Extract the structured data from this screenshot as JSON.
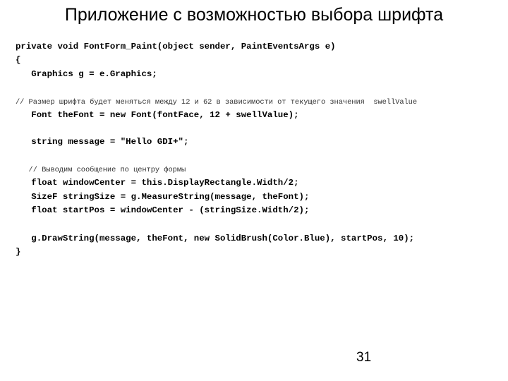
{
  "slide": {
    "title": "Приложение с возможностью выбора шрифта",
    "page_number": "31"
  },
  "code": {
    "lines": [
      "private void FontForm_Paint(object sender, PaintEventsArgs e)",
      "{",
      "   Graphics g = e.Graphics;",
      "// Размер шрифта будет меняться между 12 и 62 в зависимости от текущего значения  swellValue",
      "   Font theFont = new Font(fontFace, 12 + swellValue);",
      "   string message = \"Hello GDI+\";",
      "   // Выводим сообщение по центру формы",
      "   float windowCenter = this.DisplayRectangle.Width/2;",
      "   SizeF stringSize = g.MeasureString(message, theFont);",
      "   float startPos = windowCenter - (stringSize.Width/2);",
      "   g.DrawString(message, theFont, new SolidBrush(Color.Blue), startPos, 10);",
      "}"
    ]
  }
}
